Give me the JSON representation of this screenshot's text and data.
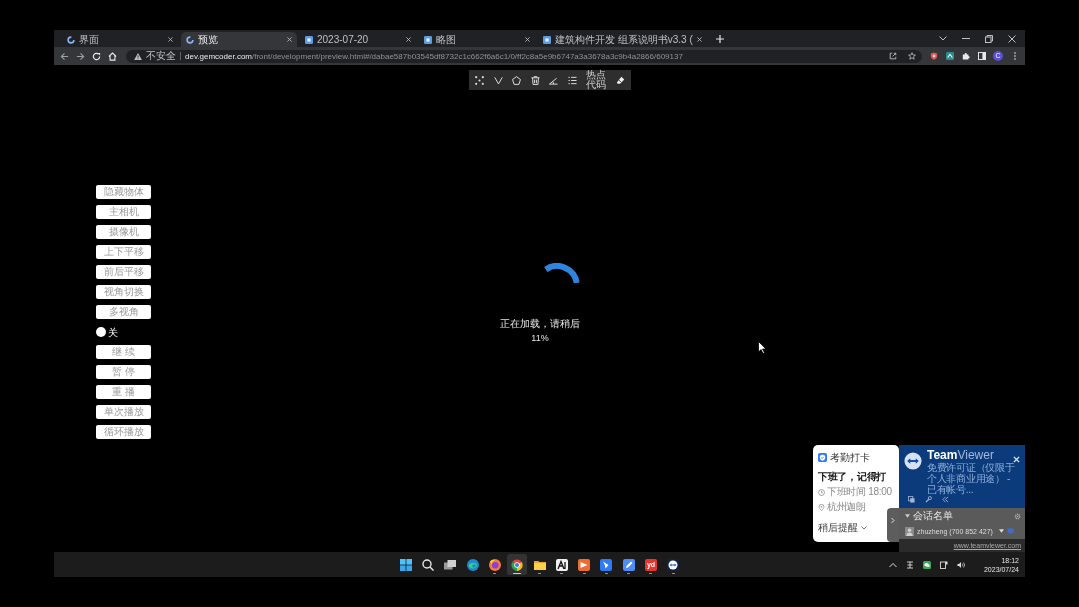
{
  "browser": {
    "tabs": [
      {
        "title": "界面",
        "kind": "loading",
        "selected": false
      },
      {
        "title": "预览",
        "kind": "loading",
        "selected": true
      },
      {
        "title": "2023-07-20",
        "kind": "page",
        "selected": false
      },
      {
        "title": "略图",
        "kind": "page",
        "selected": false
      },
      {
        "title": "建筑构件开发 组系说明书v3.3 (",
        "kind": "page",
        "selected": false
      }
    ],
    "address_bar": {
      "security": "不安全",
      "host": "dev.gemcoder.com",
      "path": "/front/development/preview.html#/dabae587b03545df8732c1c662f6a6c1/0/ff2c8a5e9b6747a3a3678a3c9b4a2866/609137"
    },
    "profile": "C"
  },
  "toolbar": {
    "tools": [
      {
        "kind": "points"
      },
      {
        "kind": "polyline"
      },
      {
        "kind": "polygon"
      },
      {
        "kind": "delete"
      },
      {
        "kind": "angle"
      },
      {
        "kind": "list"
      },
      {
        "kind": "text",
        "label": "热点代码"
      },
      {
        "kind": "eraser"
      }
    ]
  },
  "side_panel": {
    "items": [
      {
        "kind": "button",
        "label": "隐藏物体"
      },
      {
        "kind": "button",
        "label": "主相机"
      },
      {
        "kind": "button",
        "label": "摄像机"
      },
      {
        "kind": "button",
        "label": "上下平移"
      },
      {
        "kind": "button",
        "label": "前后平移"
      },
      {
        "kind": "button",
        "label": "视角切换"
      },
      {
        "kind": "button",
        "label": "多视角"
      },
      {
        "kind": "toggle",
        "label": "关",
        "on": false
      },
      {
        "kind": "button",
        "label": "继 续"
      },
      {
        "kind": "button",
        "label": "暂 停"
      },
      {
        "kind": "button",
        "label": "重 播"
      },
      {
        "kind": "button",
        "label": "单次播放"
      },
      {
        "kind": "button",
        "label": "循环播放"
      }
    ]
  },
  "loading": {
    "message": "正在加载，请稍后",
    "percent": "11%"
  },
  "notification": {
    "app": "考勤打卡",
    "title": "下班了，记得打",
    "details": [
      {
        "kind": "time",
        "text": "下班时间 18:00"
      },
      {
        "kind": "location",
        "text": "杭州迦朗"
      }
    ],
    "action": "稍后提醒"
  },
  "teamviewer": {
    "title": "**Team**Viewer",
    "description": "免费许可证（仅限于个人非商业用途） - 已有帐号...",
    "session_list": {
      "title": "会话名单",
      "contacts": [
        {
          "name": "zhuzheng (700 852 427)"
        }
      ]
    },
    "link": "www.teamviewer.com"
  },
  "taskbar": {
    "apps": [
      {
        "kind": "start",
        "running": false,
        "selected": false
      },
      {
        "kind": "search",
        "running": false,
        "selected": false
      },
      {
        "kind": "taskview",
        "running": false,
        "selected": false
      },
      {
        "kind": "edge",
        "running": false,
        "selected": false
      },
      {
        "kind": "firefox",
        "running": true,
        "selected": false
      },
      {
        "kind": "chrome",
        "running": true,
        "selected": true
      },
      {
        "kind": "folder",
        "running": true,
        "selected": false
      },
      {
        "kind": "ai",
        "running": true,
        "selected": false
      },
      {
        "kind": "orange",
        "running": true,
        "selected": false
      },
      {
        "kind": "bird",
        "running": true,
        "selected": false
      },
      {
        "kind": "pen",
        "running": true,
        "selected": false
      },
      {
        "kind": "label",
        "label": "yd",
        "running": true,
        "selected": false
      },
      {
        "kind": "remote",
        "running": true,
        "selected": false
      }
    ],
    "tray": [
      {
        "kind": "chevron"
      },
      {
        "kind": "ime"
      },
      {
        "kind": "chat"
      },
      {
        "kind": "display"
      },
      {
        "kind": "speaker"
      }
    ],
    "time": "18:12",
    "date": "2023/07/24"
  }
}
